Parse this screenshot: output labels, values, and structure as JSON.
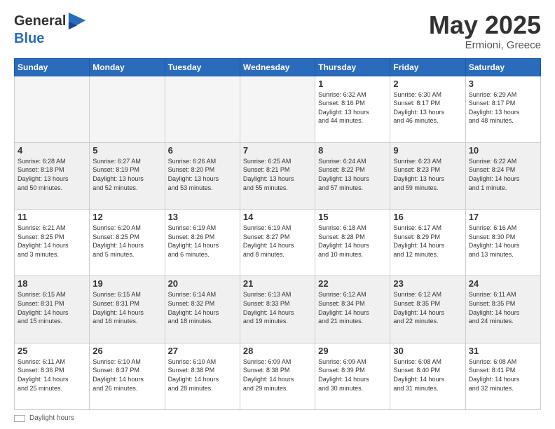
{
  "header": {
    "logo_general": "General",
    "logo_blue": "Blue",
    "month_year": "May 2025",
    "location": "Ermioni, Greece"
  },
  "weekdays": [
    "Sunday",
    "Monday",
    "Tuesday",
    "Wednesday",
    "Thursday",
    "Friday",
    "Saturday"
  ],
  "footer": {
    "daylight_label": "Daylight hours"
  },
  "weeks": [
    [
      {
        "day": "",
        "info": "",
        "empty": true
      },
      {
        "day": "",
        "info": "",
        "empty": true
      },
      {
        "day": "",
        "info": "",
        "empty": true
      },
      {
        "day": "",
        "info": "",
        "empty": true
      },
      {
        "day": "1",
        "info": "Sunrise: 6:32 AM\nSunset: 8:16 PM\nDaylight: 13 hours\nand 44 minutes."
      },
      {
        "day": "2",
        "info": "Sunrise: 6:30 AM\nSunset: 8:17 PM\nDaylight: 13 hours\nand 46 minutes."
      },
      {
        "day": "3",
        "info": "Sunrise: 6:29 AM\nSunset: 8:17 PM\nDaylight: 13 hours\nand 48 minutes."
      }
    ],
    [
      {
        "day": "4",
        "info": "Sunrise: 6:28 AM\nSunset: 8:18 PM\nDaylight: 13 hours\nand 50 minutes."
      },
      {
        "day": "5",
        "info": "Sunrise: 6:27 AM\nSunset: 8:19 PM\nDaylight: 13 hours\nand 52 minutes."
      },
      {
        "day": "6",
        "info": "Sunrise: 6:26 AM\nSunset: 8:20 PM\nDaylight: 13 hours\nand 53 minutes."
      },
      {
        "day": "7",
        "info": "Sunrise: 6:25 AM\nSunset: 8:21 PM\nDaylight: 13 hours\nand 55 minutes."
      },
      {
        "day": "8",
        "info": "Sunrise: 6:24 AM\nSunset: 8:22 PM\nDaylight: 13 hours\nand 57 minutes."
      },
      {
        "day": "9",
        "info": "Sunrise: 6:23 AM\nSunset: 8:23 PM\nDaylight: 13 hours\nand 59 minutes."
      },
      {
        "day": "10",
        "info": "Sunrise: 6:22 AM\nSunset: 8:24 PM\nDaylight: 14 hours\nand 1 minute."
      }
    ],
    [
      {
        "day": "11",
        "info": "Sunrise: 6:21 AM\nSunset: 8:25 PM\nDaylight: 14 hours\nand 3 minutes."
      },
      {
        "day": "12",
        "info": "Sunrise: 6:20 AM\nSunset: 8:25 PM\nDaylight: 14 hours\nand 5 minutes."
      },
      {
        "day": "13",
        "info": "Sunrise: 6:19 AM\nSunset: 8:26 PM\nDaylight: 14 hours\nand 6 minutes."
      },
      {
        "day": "14",
        "info": "Sunrise: 6:19 AM\nSunset: 8:27 PM\nDaylight: 14 hours\nand 8 minutes."
      },
      {
        "day": "15",
        "info": "Sunrise: 6:18 AM\nSunset: 8:28 PM\nDaylight: 14 hours\nand 10 minutes."
      },
      {
        "day": "16",
        "info": "Sunrise: 6:17 AM\nSunset: 8:29 PM\nDaylight: 14 hours\nand 12 minutes."
      },
      {
        "day": "17",
        "info": "Sunrise: 6:16 AM\nSunset: 8:30 PM\nDaylight: 14 hours\nand 13 minutes."
      }
    ],
    [
      {
        "day": "18",
        "info": "Sunrise: 6:15 AM\nSunset: 8:31 PM\nDaylight: 14 hours\nand 15 minutes."
      },
      {
        "day": "19",
        "info": "Sunrise: 6:15 AM\nSunset: 8:31 PM\nDaylight: 14 hours\nand 16 minutes."
      },
      {
        "day": "20",
        "info": "Sunrise: 6:14 AM\nSunset: 8:32 PM\nDaylight: 14 hours\nand 18 minutes."
      },
      {
        "day": "21",
        "info": "Sunrise: 6:13 AM\nSunset: 8:33 PM\nDaylight: 14 hours\nand 19 minutes."
      },
      {
        "day": "22",
        "info": "Sunrise: 6:12 AM\nSunset: 8:34 PM\nDaylight: 14 hours\nand 21 minutes."
      },
      {
        "day": "23",
        "info": "Sunrise: 6:12 AM\nSunset: 8:35 PM\nDaylight: 14 hours\nand 22 minutes."
      },
      {
        "day": "24",
        "info": "Sunrise: 6:11 AM\nSunset: 8:35 PM\nDaylight: 14 hours\nand 24 minutes."
      }
    ],
    [
      {
        "day": "25",
        "info": "Sunrise: 6:11 AM\nSunset: 8:36 PM\nDaylight: 14 hours\nand 25 minutes."
      },
      {
        "day": "26",
        "info": "Sunrise: 6:10 AM\nSunset: 8:37 PM\nDaylight: 14 hours\nand 26 minutes."
      },
      {
        "day": "27",
        "info": "Sunrise: 6:10 AM\nSunset: 8:38 PM\nDaylight: 14 hours\nand 28 minutes."
      },
      {
        "day": "28",
        "info": "Sunrise: 6:09 AM\nSunset: 8:38 PM\nDaylight: 14 hours\nand 29 minutes."
      },
      {
        "day": "29",
        "info": "Sunrise: 6:09 AM\nSunset: 8:39 PM\nDaylight: 14 hours\nand 30 minutes."
      },
      {
        "day": "30",
        "info": "Sunrise: 6:08 AM\nSunset: 8:40 PM\nDaylight: 14 hours\nand 31 minutes."
      },
      {
        "day": "31",
        "info": "Sunrise: 6:08 AM\nSunset: 8:41 PM\nDaylight: 14 hours\nand 32 minutes."
      }
    ]
  ]
}
